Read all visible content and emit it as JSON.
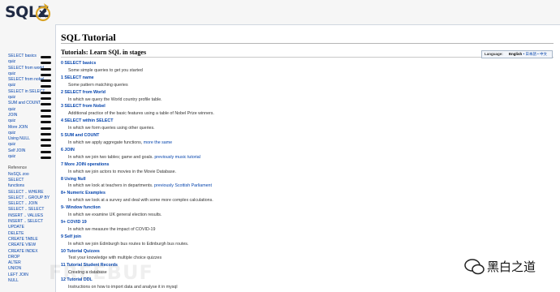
{
  "logo": {
    "text": "SQLZ"
  },
  "sidebar": {
    "items": [
      "SELECT basics",
      "quiz",
      "SELECT from world",
      "quiz",
      "SELECT from nobel",
      "quiz",
      "SELECT in SELECT",
      "quiz",
      "SUM and COUNT",
      "quiz",
      "JOIN",
      "quiz",
      "More JOIN",
      "quiz",
      "Using NULL",
      "quiz",
      "Self JOIN",
      "quiz"
    ],
    "reference_heading": "Reference",
    "reference": [
      "NoSQL zoo",
      "SELECT",
      "functions",
      "SELECT .. WHERE",
      "SELECT .. GROUP BY",
      "SELECT .. JOIN",
      "SELECT .. SELECT",
      "INSERT .. VALUES",
      "INSERT .. SELECT",
      "UPDATE",
      "DELETE",
      "CREATE TABLE",
      "CREATE VIEW",
      "CREATE INDEX",
      "DROP",
      "ALTER",
      "UNION",
      "LEFT JOIN",
      "NULL"
    ]
  },
  "page": {
    "title": "SQL Tutorial",
    "subtitle": "Tutorials: Learn SQL in stages"
  },
  "language": {
    "label": "Language:",
    "current": "English",
    "others": " • 日本語 • 中文"
  },
  "tutorials": [
    {
      "title": "0 SELECT basics",
      "desc": "Some simple queries to get you started",
      "link": ""
    },
    {
      "title": "1 SELECT name",
      "desc": "Some pattern matching queries",
      "link": ""
    },
    {
      "title": "2 SELECT from World",
      "desc": "In which we query the World country profile table.",
      "link": ""
    },
    {
      "title": "3 SELECT from Nobel",
      "desc": "Additional practice of the basic features using a table of Nobel Prize winners.",
      "link": ""
    },
    {
      "title": "4 SELECT within SELECT",
      "desc": "In which we form queries using other queries.",
      "link": ""
    },
    {
      "title": "5 SUM and COUNT",
      "desc": "In which we apply aggregate functions,",
      "link": "more the same"
    },
    {
      "title": "6 JOIN",
      "desc": "In which we join two tables; game and goals.",
      "link": "previously music tutorial"
    },
    {
      "title": "7 More JOIN operations",
      "desc": "In which we join actors to movies in the Movie Database.",
      "link": ""
    },
    {
      "title": "8 Using Null",
      "desc": "In which we look at teachers in departments.",
      "link": "previously Scottish Parliament"
    },
    {
      "title": "8+ Numeric Examples",
      "desc": "In which we look at a survey and deal with some more complex calculations.",
      "link": ""
    },
    {
      "title": "9- Window function",
      "desc": "In which we examine UK general election results.",
      "link": ""
    },
    {
      "title": "9+ COVID 19",
      "desc": "In which we measure the impact of COVID-19",
      "link": ""
    },
    {
      "title": "9 Self join",
      "desc": "In which we join Edinburgh bus routes to Edinburgh bus routes.",
      "link": ""
    },
    {
      "title": "10 Tutorial Quizzes",
      "desc": "Test your knowledge with multiple choice quizzes",
      "link": ""
    },
    {
      "title": "11 Tutorial Student Records",
      "desc": "Creating a database",
      "link": ""
    },
    {
      "title": "12 Tutorial DDL",
      "desc": "Instructions on how to import data and analyse it in mysql",
      "link": ""
    }
  ],
  "watermark": {
    "text": "FREEBUF",
    "wechat": "黑白之道"
  }
}
